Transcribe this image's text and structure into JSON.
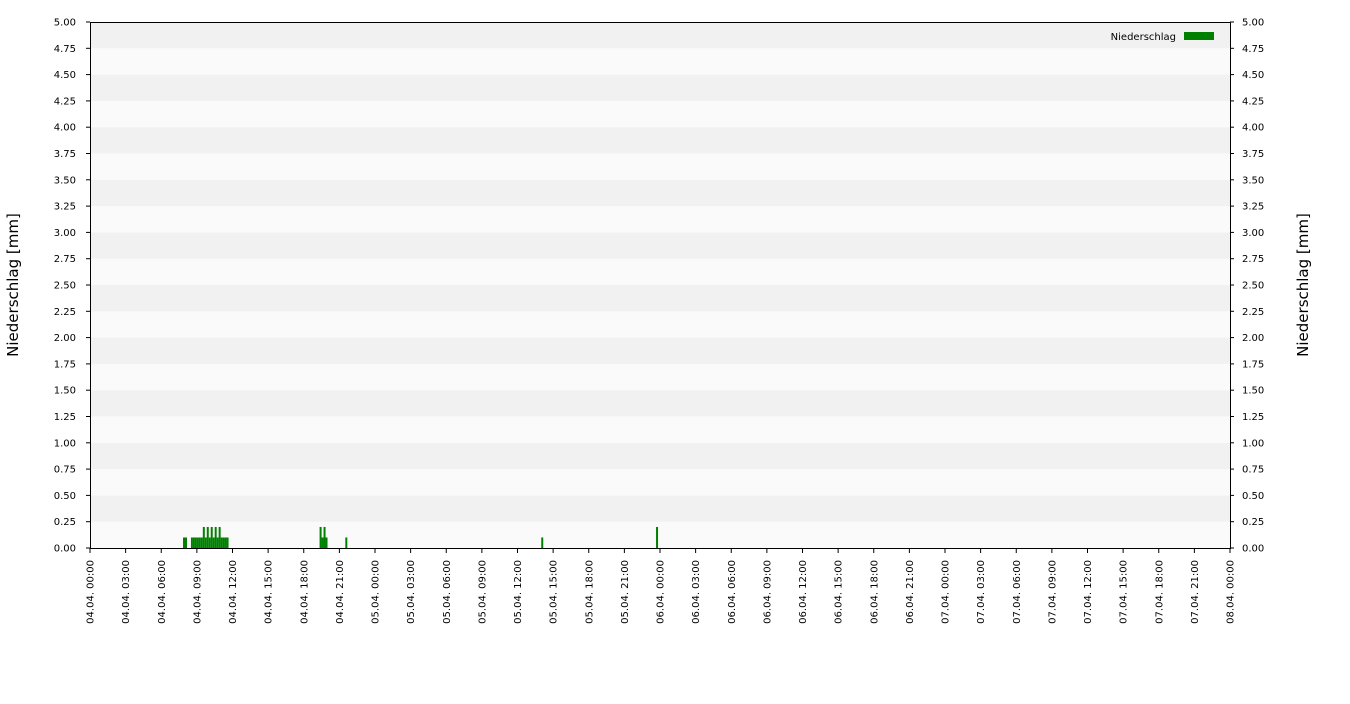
{
  "chart_data": {
    "type": "bar",
    "legend": {
      "label": "Niederschlag",
      "position": "top-right"
    },
    "ylabel_left": "Niederschlag [mm]",
    "ylabel_right": "Niederschlag [mm]",
    "ylim": [
      0,
      5
    ],
    "yticks": [
      "0.00",
      "0.25",
      "0.50",
      "0.75",
      "1.00",
      "1.25",
      "1.50",
      "1.75",
      "2.00",
      "2.25",
      "2.50",
      "2.75",
      "3.00",
      "3.25",
      "3.50",
      "3.75",
      "4.00",
      "4.25",
      "4.50",
      "4.75",
      "5.00"
    ],
    "x_start": "04.04. 00:00",
    "x_end": "08.04. 00:00",
    "x_range_hours": [
      0,
      96
    ],
    "xticks": [
      "04.04. 00:00",
      "04.04. 03:00",
      "04.04. 06:00",
      "04.04. 09:00",
      "04.04. 12:00",
      "04.04. 15:00",
      "04.04. 18:00",
      "04.04. 21:00",
      "05.04. 00:00",
      "05.04. 03:00",
      "05.04. 06:00",
      "05.04. 09:00",
      "05.04. 12:00",
      "05.04. 15:00",
      "05.04. 18:00",
      "05.04. 21:00",
      "06.04. 00:00",
      "06.04. 03:00",
      "06.04. 06:00",
      "06.04. 09:00",
      "06.04. 12:00",
      "06.04. 15:00",
      "06.04. 18:00",
      "06.04. 21:00",
      "07.04. 00:00",
      "07.04. 03:00",
      "07.04. 06:00",
      "07.04. 09:00",
      "07.04. 12:00",
      "07.04. 15:00",
      "07.04. 18:00",
      "07.04. 21:00",
      "08.04. 00:00"
    ],
    "grid": true,
    "series": [
      {
        "name": "Niederschlag",
        "color": "#008000",
        "points": [
          {
            "time": "04.04. 07:50",
            "value": 0.1
          },
          {
            "time": "04.04. 08:00",
            "value": 0.1
          },
          {
            "time": "04.04. 08:30",
            "value": 0.1
          },
          {
            "time": "04.04. 08:40",
            "value": 0.1
          },
          {
            "time": "04.04. 08:50",
            "value": 0.1
          },
          {
            "time": "04.04. 09:00",
            "value": 0.1
          },
          {
            "time": "04.04. 09:10",
            "value": 0.1
          },
          {
            "time": "04.04. 09:20",
            "value": 0.1
          },
          {
            "time": "04.04. 09:30",
            "value": 0.2
          },
          {
            "time": "04.04. 09:40",
            "value": 0.1
          },
          {
            "time": "04.04. 09:50",
            "value": 0.2
          },
          {
            "time": "04.04. 10:00",
            "value": 0.1
          },
          {
            "time": "04.04. 10:10",
            "value": 0.2
          },
          {
            "time": "04.04. 10:20",
            "value": 0.1
          },
          {
            "time": "04.04. 10:30",
            "value": 0.2
          },
          {
            "time": "04.04. 10:40",
            "value": 0.1
          },
          {
            "time": "04.04. 10:50",
            "value": 0.2
          },
          {
            "time": "04.04. 11:00",
            "value": 0.1
          },
          {
            "time": "04.04. 11:10",
            "value": 0.1
          },
          {
            "time": "04.04. 11:20",
            "value": 0.1
          },
          {
            "time": "04.04. 11:30",
            "value": 0.1
          },
          {
            "time": "04.04. 19:20",
            "value": 0.2
          },
          {
            "time": "04.04. 19:30",
            "value": 0.1
          },
          {
            "time": "04.04. 19:40",
            "value": 0.2
          },
          {
            "time": "04.04. 19:50",
            "value": 0.1
          },
          {
            "time": "04.04. 21:30",
            "value": 0.1
          },
          {
            "time": "05.04. 14:00",
            "value": 0.1
          },
          {
            "time": "05.04. 23:40",
            "value": 0.2
          }
        ]
      }
    ]
  }
}
